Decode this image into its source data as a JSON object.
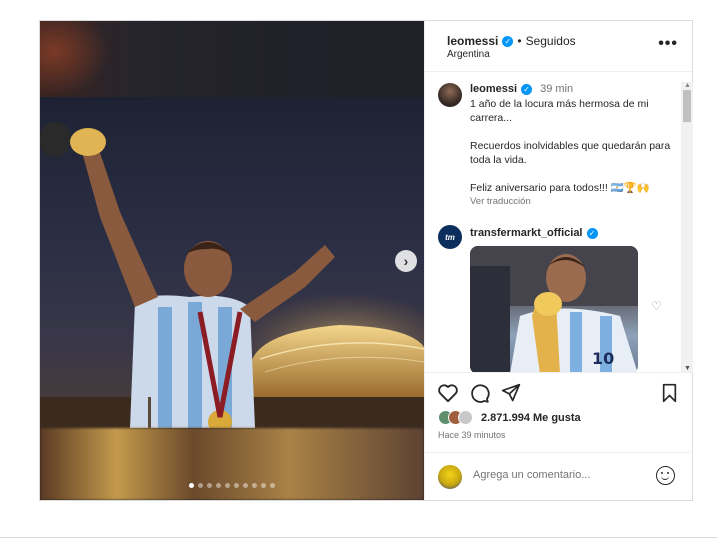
{
  "header": {
    "username": "leomessi",
    "separator": "•",
    "follow_status": "Seguidos",
    "location": "Argentina",
    "more_icon": "more-horizontal-icon"
  },
  "caption": {
    "username": "leomessi",
    "time": "39 min",
    "text": "1 año de la locura más hermosa de mi carrera...\n\nRecuerdos inolvidables que quedarán para toda la vida.\n\nFeliz aniversario para todos!!! 🇦🇷🏆🙌",
    "translate_label": "Ver traducción"
  },
  "comment": {
    "username": "transfermarkt_official",
    "avatar_text": "tm"
  },
  "carousel": {
    "dots_total": 10,
    "active_index": 0
  },
  "actions": {
    "likes": "2.871.994 Me gusta",
    "posted": "Hace 39 minutos",
    "icons": [
      "heart-icon",
      "comment-icon",
      "share-icon",
      "bookmark-icon"
    ]
  },
  "comment_box": {
    "placeholder": "Agrega un comentario..."
  },
  "colors": {
    "verified": "#0095f6",
    "text": "#262626",
    "muted": "#737373"
  }
}
